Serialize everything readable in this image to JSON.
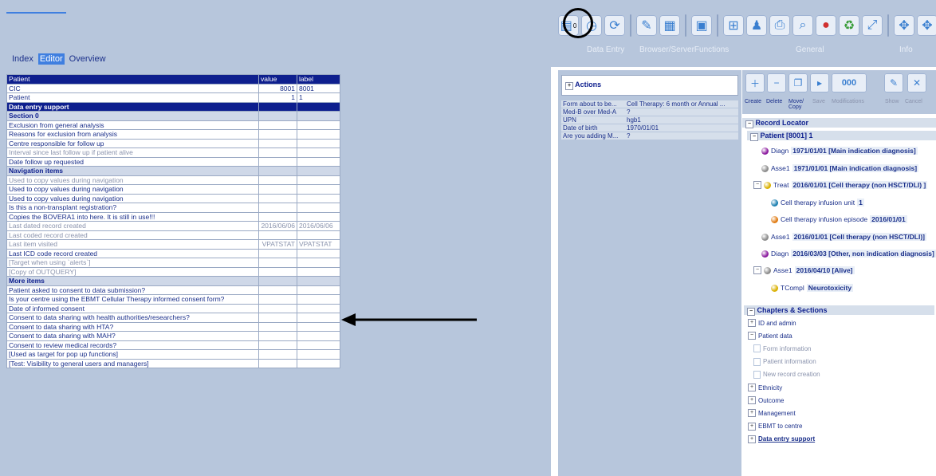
{
  "nav": {
    "tabs": [
      "Index",
      "Editor",
      "Overview"
    ],
    "active": "Editor"
  },
  "grid": {
    "headers": [
      "Patient",
      "value",
      "label"
    ],
    "rows": [
      {
        "label": "CIC",
        "value": "8001",
        "lab": "8001",
        "style": ""
      },
      {
        "label": "Patient",
        "value": "1",
        "lab": "1",
        "style": ""
      },
      {
        "label": "Data entry support",
        "value": "",
        "lab": "",
        "style": "section"
      },
      {
        "label": "Section 0",
        "value": "",
        "lab": "",
        "style": "sub"
      },
      {
        "label": "Exclusion from general analysis",
        "value": "",
        "lab": "",
        "style": ""
      },
      {
        "label": "Reasons for exclusion from analysis",
        "value": "",
        "lab": "",
        "style": ""
      },
      {
        "label": "Centre responsible for follow up",
        "value": "",
        "lab": "",
        "style": ""
      },
      {
        "label": "Interval since last follow up if patient alive",
        "value": "",
        "lab": "",
        "style": "gray"
      },
      {
        "label": "Date follow up requested",
        "value": "",
        "lab": "",
        "style": ""
      },
      {
        "label": "Navigation items",
        "value": "",
        "lab": "",
        "style": "sub"
      },
      {
        "label": "Used to copy values during navigation",
        "value": "",
        "lab": "",
        "style": "gray"
      },
      {
        "label": "Used to copy values during navigation",
        "value": "",
        "lab": "",
        "style": ""
      },
      {
        "label": "Used to copy values during navigation",
        "value": "",
        "lab": "",
        "style": ""
      },
      {
        "label": "Is this a non-transplant registration?",
        "value": "",
        "lab": "",
        "style": ""
      },
      {
        "label": "Copies the BOVERA1 into here. It is still in use!!!",
        "value": "",
        "lab": "",
        "style": ""
      },
      {
        "label": "Last dated record created",
        "value": "2016/06/06",
        "lab": "2016/06/06",
        "style": "gray"
      },
      {
        "label": "Last coded record created",
        "value": "",
        "lab": "",
        "style": "gray"
      },
      {
        "label": "Last item visited",
        "value": "VPATSTAT",
        "lab": "VPATSTAT",
        "style": "gray"
      },
      {
        "label": "Last ICD code record created",
        "value": "",
        "lab": "",
        "style": ""
      },
      {
        "label": "[Target when using `alerts`]",
        "value": "",
        "lab": "",
        "style": "gray"
      },
      {
        "label": "[Copy of OUTQUERY]",
        "value": "",
        "lab": "",
        "style": "gray"
      },
      {
        "label": "More items",
        "value": "",
        "lab": "",
        "style": "sub"
      },
      {
        "label": "Patient asked to consent to data submission?",
        "value": "",
        "lab": "",
        "style": ""
      },
      {
        "label": "Is your centre using the EBMT Cellular Therapy informed consent form?",
        "value": "",
        "lab": "",
        "style": ""
      },
      {
        "label": "Date of informed consent",
        "value": "",
        "lab": "",
        "style": ""
      },
      {
        "label": "Consent to data sharing with health authorities/researchers?",
        "value": "",
        "lab": "",
        "style": ""
      },
      {
        "label": "Consent to data sharing with HTA?",
        "value": "",
        "lab": "",
        "style": ""
      },
      {
        "label": "Consent to data sharing with MAH?",
        "value": "",
        "lab": "",
        "style": ""
      },
      {
        "label": "Consent to review medical records?",
        "value": "",
        "lab": "",
        "style": ""
      },
      {
        "label": "[Used as target for pop up functions]",
        "value": "",
        "lab": "",
        "style": ""
      },
      {
        "label": "[Test: Visibility to general users and managers]",
        "value": "",
        "lab": "",
        "style": ""
      }
    ]
  },
  "toolbar": {
    "groups": [
      "Data Entry",
      "Browser/ServerFunctions",
      "General",
      "Info"
    ],
    "badge": "0"
  },
  "actions": {
    "title": "Actions",
    "rows": [
      {
        "k": "Form about to be...",
        "v": "Cell Therapy: 6 month or Annual ..."
      },
      {
        "k": "Med-B over Med-A",
        "v": "?"
      },
      {
        "k": "UPN",
        "v": "hgb1"
      },
      {
        "k": "Date of birth",
        "v": "1970/01/01"
      },
      {
        "k": "Are you adding M...",
        "v": "?"
      }
    ]
  },
  "record_buttons": {
    "create": "Create",
    "delete": "Delete",
    "move": "Move/ Copy",
    "save": "Save",
    "modifications": "Modifications",
    "show": "Show",
    "cancel": "Cancel",
    "counter": "000"
  },
  "record_locator": {
    "title": "Record Locator",
    "patient": "Patient [8001] 1",
    "items": [
      {
        "code": "Diagn",
        "text": "1971/01/01 [Main indication diagnosis]",
        "color": "#8b1a9e",
        "indent": 0
      },
      {
        "code": "Asse1",
        "text": "1971/01/01 [Main indication diagnosis]",
        "color": "#8a8a8a",
        "indent": 0
      },
      {
        "code": "Treat",
        "text": "2016/01/01 [Cell therapy (non HSCT/DLI) ]",
        "color": "#d9b000",
        "indent": 0
      },
      {
        "code": "Cell therapy infusion unit",
        "text": "1",
        "color": "#1b7fb0",
        "indent": 1
      },
      {
        "code": "Cell therapy infusion episode",
        "text": "2016/01/01",
        "color": "#e07a10",
        "indent": 1
      },
      {
        "code": "Asse1",
        "text": "2016/01/01 [Cell therapy (non HSCT/DLI)]",
        "color": "#8a8a8a",
        "indent": 0
      },
      {
        "code": "Diagn",
        "text": "2016/03/03 [Other, non indication diagnosis]",
        "color": "#8b1a9e",
        "indent": 0
      },
      {
        "code": "Asse1",
        "text": "2016/04/10 [Alive]",
        "color": "#8a8a8a",
        "indent": 0
      },
      {
        "code": "TCompl",
        "text": "Neurotoxicity",
        "color": "#d9b000",
        "indent": 1
      }
    ]
  },
  "chapters": {
    "title": "Chapters & Sections",
    "items": [
      {
        "label": "ID and admin",
        "kind": "plus"
      },
      {
        "label": "Patient data",
        "kind": "minus"
      },
      {
        "label": "Form information",
        "kind": "leaf"
      },
      {
        "label": "Patient information",
        "kind": "leaf"
      },
      {
        "label": "New record creation",
        "kind": "leaf"
      },
      {
        "label": "Ethnicity",
        "kind": "plus"
      },
      {
        "label": "Outcome",
        "kind": "plus"
      },
      {
        "label": "Management",
        "kind": "plus"
      },
      {
        "label": "EBMT to centre",
        "kind": "plus"
      },
      {
        "label": "Data entry support",
        "kind": "plus"
      }
    ]
  }
}
